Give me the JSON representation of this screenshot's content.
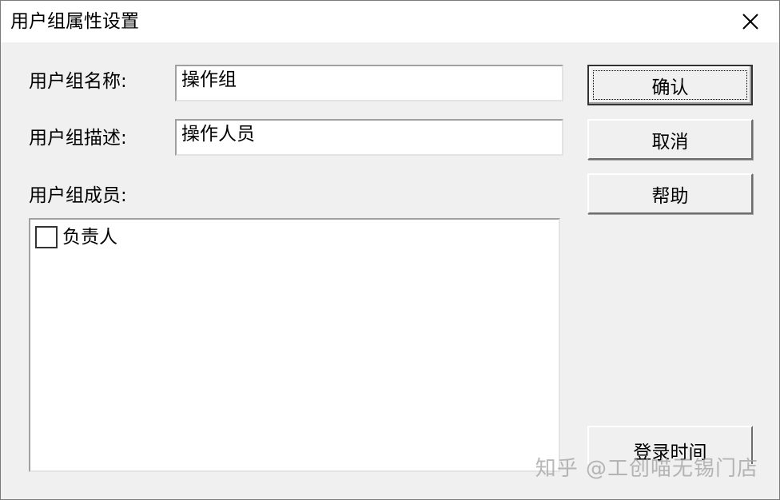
{
  "window": {
    "title": "用户组属性设置",
    "close_icon": "close-icon"
  },
  "form": {
    "name_label": "用户组名称:",
    "name_value": "操作组",
    "desc_label": "用户组描述:",
    "desc_value": "操作人员",
    "members_label": "用户组成员:"
  },
  "members": {
    "items": [
      {
        "label": "负责人",
        "checked": false
      }
    ]
  },
  "buttons": {
    "confirm": "确认",
    "cancel": "取消",
    "help": "帮助",
    "login_time": "登录时间"
  },
  "watermark": {
    "text": "知乎 @工创喵无锡门店"
  }
}
